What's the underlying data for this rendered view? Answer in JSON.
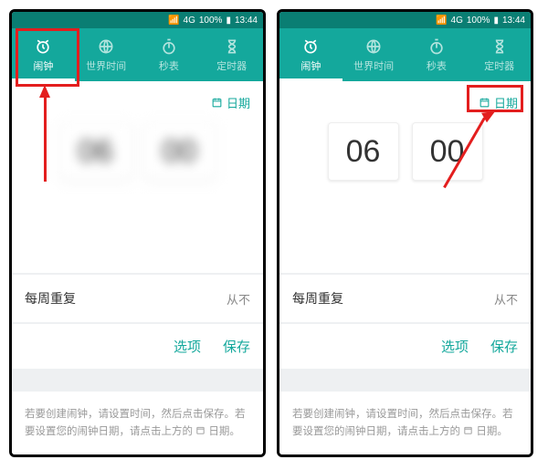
{
  "status": {
    "signal": "4G",
    "battery": "100%",
    "time": "13:44"
  },
  "tabs": {
    "alarm": "闹钟",
    "world": "世界时间",
    "stopwatch": "秒表",
    "timer": "定时器"
  },
  "date_label": "日期",
  "time": {
    "hour": "06",
    "minute": "00"
  },
  "repeat": {
    "label": "每周重复",
    "value": "从不"
  },
  "actions": {
    "options": "选项",
    "save": "保存"
  },
  "hint": {
    "line1": "若要创建闹钟，请设置时间，然后点击保存。若",
    "line2": "要设置您的闹钟日期，请点击上方的",
    "icon_label": "日期。"
  }
}
